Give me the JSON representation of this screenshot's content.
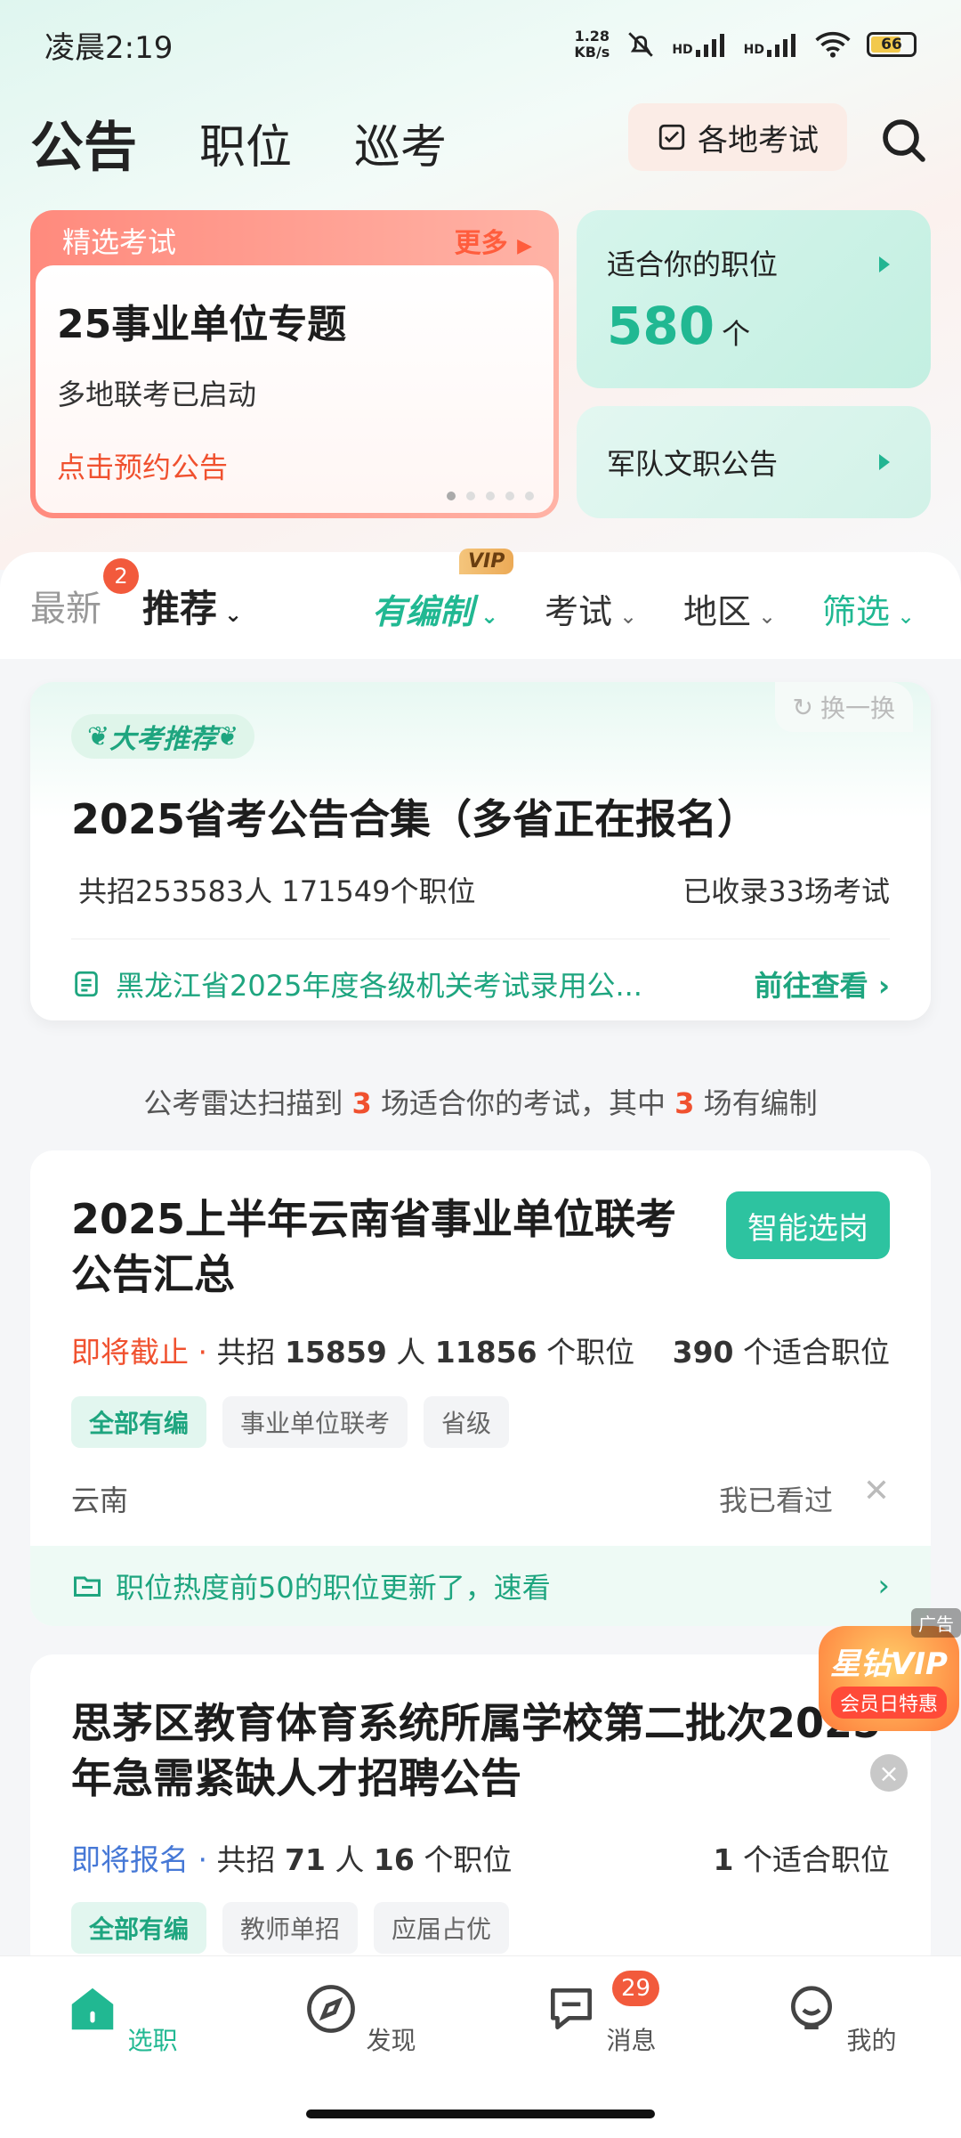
{
  "status_bar": {
    "time": "凌晨2:19",
    "net_speed_top": "1.28",
    "net_speed_bottom": "KB/s",
    "hd1": "HD",
    "hd2": "HD",
    "battery": "66",
    "battery_level": 0.66
  },
  "header": {
    "tabs": [
      {
        "label": "公告"
      },
      {
        "label": "职位"
      },
      {
        "label": "巡考"
      }
    ],
    "exam_button": "各地考试"
  },
  "featured": {
    "header": "精选考试",
    "more": "更多",
    "title": "25事业单位专题",
    "subtitle": "多地联考已启动",
    "link": "点击预约公告"
  },
  "positions_card": {
    "title": "适合你的职位",
    "count": "580",
    "unit": "个"
  },
  "army_card": {
    "title": "军队文职公告"
  },
  "filters": {
    "latest": "最新",
    "latest_badge": "2",
    "recommend": "推荐",
    "bianzhi": "有编制",
    "vip": "VIP",
    "exam": "考试",
    "region": "地区",
    "screen": "筛选"
  },
  "recommend_card": {
    "badge": "大考推荐",
    "swap": "换一换",
    "title": "2025省考公告合集（多省正在报名）",
    "stat": "共招253583人 171549个职位",
    "count": "已收录33场考试",
    "notice": "黑龙江省2025年度各级机关考试录用公...",
    "go": "前往查看"
  },
  "radar": {
    "part1": "公考雷达扫描到 ",
    "num1": "3",
    "part2": " 场适合你的考试，其中 ",
    "num2": "3",
    "part3": " 场有编制"
  },
  "jobs": [
    {
      "title": "2025上半年云南省事业单位联考公告汇总",
      "button": "智能选岗",
      "status": "即将截止",
      "dot": " · ",
      "recruit_prefix": "共招 ",
      "recruit_num": "15859",
      "recruit_suffix": " 人 ",
      "positions_num": "11856",
      "positions_suffix": " 个职位",
      "fit_num": "390",
      "fit_suffix": " 个适合职位",
      "tags": [
        "全部有编",
        "事业单位联考",
        "省级"
      ],
      "region": "云南",
      "seen": "我已看过",
      "close": "✕",
      "footer": "职位热度前50的职位更新了，速看"
    },
    {
      "title": "思茅区教育体育系统所属学校第二批次2025年急需紧缺人才招聘公告",
      "status": "即将报名",
      "dot": " · ",
      "recruit_prefix": "共招 ",
      "recruit_num": "71",
      "recruit_suffix": " 人 ",
      "positions_num": "16",
      "positions_suffix": " 个职位",
      "fit_num": "1",
      "fit_suffix": " 个适合职位",
      "tags": [
        "全部有编",
        "教师单招",
        "应届占优"
      ]
    }
  ],
  "ad": {
    "label": "广告",
    "title": "星钻VIP",
    "subtitle": "会员日特惠"
  },
  "bottom_nav": [
    {
      "label": "选职"
    },
    {
      "label": "发现"
    },
    {
      "label": "消息",
      "badge": "29"
    },
    {
      "label": "我的"
    }
  ],
  "colors": {
    "accent": "#21b892",
    "red": "#f0512f",
    "blue": "#4678d6"
  }
}
